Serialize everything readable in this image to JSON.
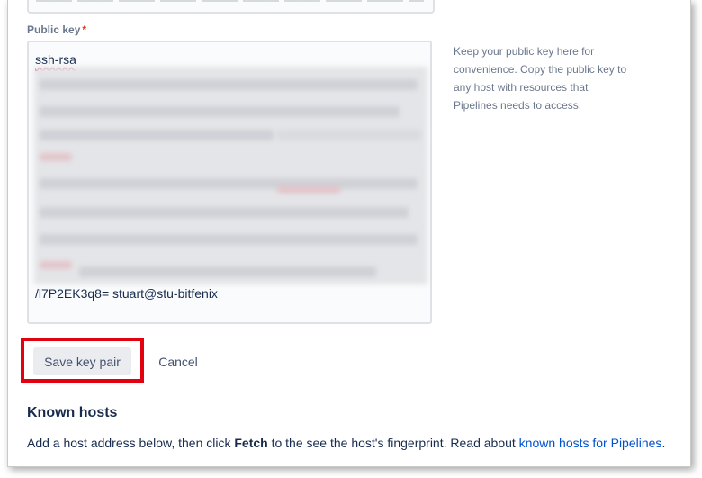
{
  "public_key": {
    "label": "Public key",
    "required_marker": "*",
    "first_line": "ssh-rsa",
    "last_line": "/l7P2EK3q8= stuart@stu-bitfenix",
    "help_text": "Keep your public key here for convenience. Copy the public key to any host with resources that Pipelines needs to access."
  },
  "actions": {
    "save_label": "Save key pair",
    "cancel_label": "Cancel"
  },
  "known_hosts": {
    "title": "Known hosts",
    "desc_part1": "Add a host address below, then click ",
    "desc_bold": "Fetch",
    "desc_part2": " to the see the host's fingerprint. Read about ",
    "desc_link": "known hosts for Pipelines",
    "desc_end": "."
  },
  "colors": {
    "highlight": "#E3000F",
    "link": "#0052CC",
    "required": "#DE350B",
    "text": "#172B4D"
  }
}
